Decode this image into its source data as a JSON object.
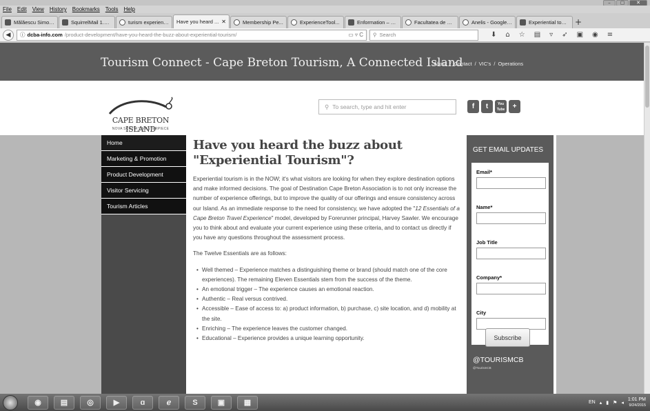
{
  "window": {
    "min": "–",
    "max": "▢",
    "close": "✕"
  },
  "menu": [
    "File",
    "Edit",
    "View",
    "History",
    "Bookmarks",
    "Tools",
    "Help"
  ],
  "tabs": [
    {
      "label": "Mălăescu Simona",
      "icon": "facebook-icon",
      "active": false
    },
    {
      "label": "SquirrelMail 1.4....",
      "icon": "squirrelmail-icon",
      "active": false
    },
    {
      "label": "turism experient...",
      "icon": "google-icon",
      "active": false
    },
    {
      "label": "Have you heard ...",
      "icon": "page-icon",
      "active": true
    },
    {
      "label": "Membership Pe...",
      "icon": "page-icon",
      "active": false
    },
    {
      "label": "ExperienceTool...",
      "icon": "page-icon",
      "active": false
    },
    {
      "label": "Enformation – R...",
      "icon": "page-icon",
      "active": false
    },
    {
      "label": "Facultatea de G...",
      "icon": "page-icon",
      "active": false
    },
    {
      "label": "Anelis - Google ...",
      "icon": "google-icon",
      "active": false
    },
    {
      "label": "Experiential tour...",
      "icon": "page-icon",
      "active": false
    }
  ],
  "new_tab": "+",
  "address": {
    "host": "dcba-info.com",
    "path": "/product-development/have-you-heard-the-buzz-about-experiential-tourism/",
    "search_placeholder": "Search"
  },
  "site": {
    "title": "Tourism Connect - Cape Breton Tourism, A Connected Island",
    "top_links": [
      "About",
      "/",
      "Contact",
      "/",
      "VIC's",
      "/",
      "Operations"
    ],
    "logo_text": "CAPE BRETON ISLAND",
    "logo_sub": "NOVA SCOTIA'S MASTERPIECE",
    "search_placeholder": "To search, type and hit enter",
    "social": [
      "f",
      "t",
      "You Tube",
      "+"
    ]
  },
  "nav": [
    "Home",
    "Marketing & Promotion",
    "Product Development",
    "Visitor Servicing",
    "Tourism Articles"
  ],
  "article": {
    "headline": "Have you heard the buzz about \"Experiential Tourism\"?",
    "p1_a": "Experiential tourism is in the NOW; it's what visitors are looking for when they explore destination options and make informed decisions.  The goal of Destination Cape Breton Association is to not only increase the number of experience offerings, but to improve the quality of our offerings and ensure consistency across our Island. As an immediate response to the need for consistency, we have adopted the \"",
    "p1_em": "12 Essentials of a Cape Breton Travel Experience",
    "p1_b": "\" model, developed by Forerunner principal, Harvey Sawler.  We encourage you to think about and evaluate your current experience using these criteria, and to contact us directly if you have any questions throughout the assessment process.",
    "p2": "The Twelve Essentials are as follows:",
    "bullets": [
      "Well themed – Experience matches a distinguishing theme or brand (should match one of the core experiences).  The remaining Eleven Essentials stem from the success of the theme.",
      "An emotional trigger – The experience causes an emotional reaction.",
      "Authentic – Real versus contrived.",
      "Accessible – Ease of access to: a) product information, b) purchase, c) site location, and d) mobility at the site.",
      "Enriching – The experience leaves the customer changed.",
      "Educational – Experience provides a unique learning opportunity."
    ]
  },
  "signup": {
    "title": "GET EMAIL UPDATES",
    "fields": [
      {
        "label": "Email",
        "required": "*"
      },
      {
        "label": "Name",
        "required": "*"
      },
      {
        "label": "Job Title",
        "required": ""
      },
      {
        "label": "Company",
        "required": "*"
      },
      {
        "label": "City",
        "required": ""
      }
    ],
    "button": "Subscribe",
    "twitter_handle": "@TOURISMCB",
    "twitter_sub": "@TourismCB"
  },
  "taskbar": {
    "icons": [
      "ie-icon",
      "explorer-icon",
      "media-icon",
      "play-icon",
      "app-a-icon",
      "app-e-icon",
      "skype-icon",
      "app-window-icon",
      "app-doc-icon"
    ],
    "icon_glyphs": [
      "◉",
      "▤",
      "◎",
      "▶",
      "ɑ",
      "ℯ",
      "S",
      "▣",
      "▦"
    ],
    "lang": "EN",
    "time": "1:01 PM",
    "date": "9/24/2015"
  }
}
